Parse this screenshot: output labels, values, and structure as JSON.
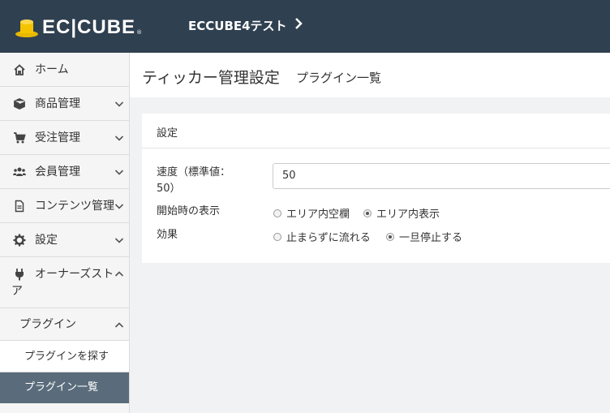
{
  "header": {
    "logo_text": "EC|CUBE",
    "logo_reg": "®",
    "shop_name": "ECCUBE4テスト"
  },
  "sidebar": {
    "items": [
      {
        "label": "ホーム",
        "icon": "home-icon"
      },
      {
        "label": "商品管理",
        "icon": "box-icon"
      },
      {
        "label": "受注管理",
        "icon": "cart-icon"
      },
      {
        "label": "会員管理",
        "icon": "users-icon"
      },
      {
        "label": "コンテンツ管理",
        "icon": "file-icon"
      },
      {
        "label": "設定",
        "icon": "gear-icon"
      },
      {
        "label_line1": "オーナーズスト",
        "label_line2": "ア",
        "icon": "plug-icon"
      }
    ],
    "plugin_group": "プラグイン",
    "plugin_search": "プラグインを探す",
    "plugin_list": "プラグイン一覧"
  },
  "page": {
    "title": "ティッカー管理設定",
    "subtitle": "プラグイン一覧"
  },
  "card": {
    "heading": "設定",
    "speed_label_line1": "速度（標準値：",
    "speed_label_line2": "50）",
    "speed_value": "50",
    "start_label": "開始時の表示",
    "start_options": [
      "エリア内空欄",
      "エリア内表示"
    ],
    "start_selected": "エリア内表示",
    "effect_label": "効果",
    "effect_options": [
      "止まらずに流れる",
      "一旦停止する"
    ],
    "effect_selected": "一旦停止する"
  },
  "colors": {
    "header_bg": "#2f4050",
    "active_item_bg": "#5a6c7b",
    "page_bg": "#f0f2f4"
  }
}
